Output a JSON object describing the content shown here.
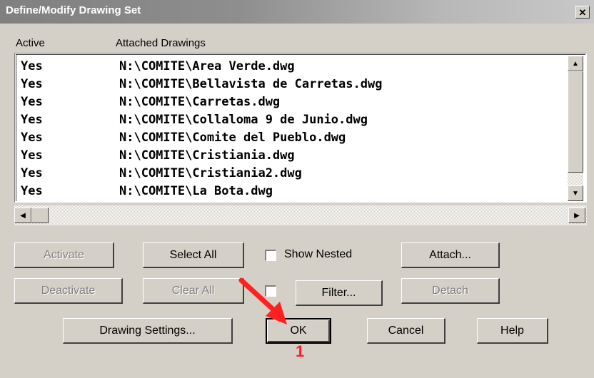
{
  "window": {
    "title": "Define/Modify Drawing Set",
    "close_glyph": "✕"
  },
  "list": {
    "headers": [
      "Active",
      "Attached Drawings"
    ],
    "rows": [
      {
        "active": "Yes",
        "drawing": "N:\\COMITE\\Area Verde.dwg"
      },
      {
        "active": "Yes",
        "drawing": "N:\\COMITE\\Bellavista de Carretas.dwg"
      },
      {
        "active": "Yes",
        "drawing": "N:\\COMITE\\Carretas.dwg"
      },
      {
        "active": "Yes",
        "drawing": "N:\\COMITE\\Collaloma 9 de Junio.dwg"
      },
      {
        "active": "Yes",
        "drawing": "N:\\COMITE\\Comite del Pueblo.dwg"
      },
      {
        "active": "Yes",
        "drawing": "N:\\COMITE\\Cristiania.dwg"
      },
      {
        "active": "Yes",
        "drawing": "N:\\COMITE\\Cristiania2.dwg"
      },
      {
        "active": "Yes",
        "drawing": "N:\\COMITE\\La Bota.dwg"
      }
    ]
  },
  "buttons": {
    "activate": "Activate",
    "select_all": "Select All",
    "show_nested": "Show Nested",
    "attach": "Attach...",
    "deactivate": "Deactivate",
    "clear_all": "Clear All",
    "filter": "Filter...",
    "detach": "Detach",
    "drawing_settings": "Drawing Settings...",
    "ok": "OK",
    "cancel": "Cancel",
    "help": "Help"
  },
  "annotation": {
    "number": "1",
    "color": "#ff2020"
  },
  "icons": {
    "up": "scroll-up-arrow",
    "down": "scroll-down-arrow",
    "left": "scroll-left-arrow",
    "right": "scroll-right-arrow"
  }
}
